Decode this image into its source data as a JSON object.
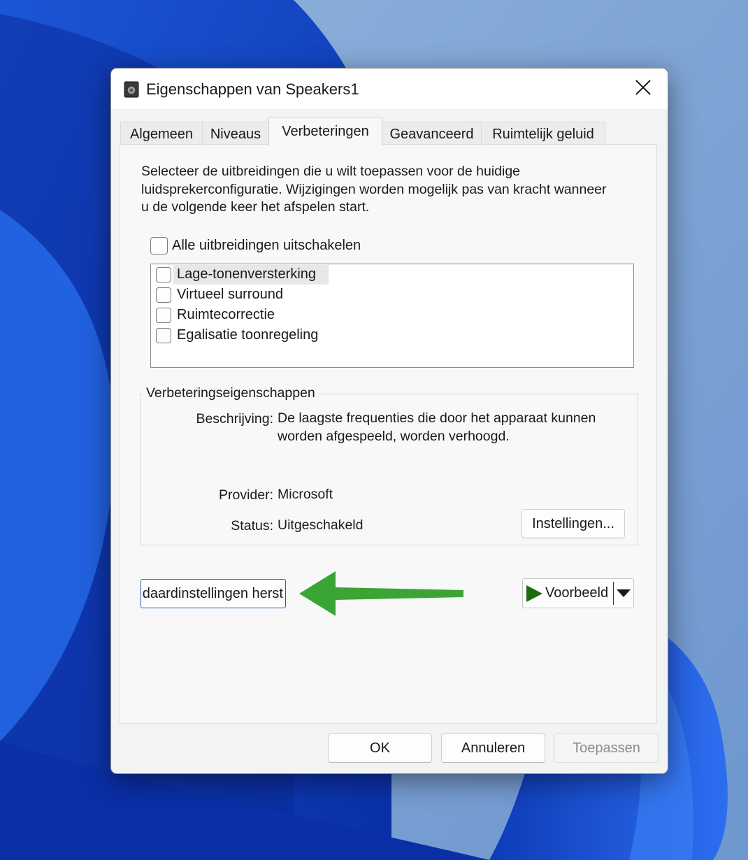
{
  "dialog": {
    "title": "Eigenschappen van Speakers1",
    "tabs": [
      "Algemeen",
      "Niveaus",
      "Verbeteringen",
      "Geavanceerd",
      "Ruimtelijk geluid"
    ],
    "active_tab": "Verbeteringen",
    "intro_text": "Selecteer de uitbreidingen die u wilt toepassen voor de huidige luidsprekerconfiguratie. Wijzigingen worden mogelijk pas van kracht wanneer u de volgende keer het afspelen start.",
    "disable_all": {
      "label": "Alle uitbreidingen uitschakelen",
      "checked": false
    },
    "enhancements": [
      {
        "label": "Lage-tonenversterking",
        "checked": false,
        "selected": true
      },
      {
        "label": "Virtueel surround",
        "checked": false,
        "selected": false
      },
      {
        "label": "Ruimtecorrectie",
        "checked": false,
        "selected": false
      },
      {
        "label": "Egalisatie toonregeling",
        "checked": false,
        "selected": false
      }
    ],
    "properties": {
      "caption": "Verbeteringseigenschappen",
      "description_label": "Beschrijving:",
      "description_value": "De laagste frequenties die door het apparaat kunnen worden afgespeeld, worden verhoogd.",
      "provider_label": "Provider:",
      "provider_value": "Microsoft",
      "status_label": "Status:",
      "status_value": "Uitgeschakeld",
      "settings_button": "Instellingen..."
    },
    "restore_button": "daardinstellingen herst",
    "preview_button": "Voorbeeld",
    "footer": {
      "ok": "OK",
      "cancel": "Annuleren",
      "apply": "Toepassen"
    }
  },
  "colors": {
    "accent_arrow": "#3aa535",
    "focus_border": "#1f5fb8",
    "play_icon": "#1f6b12"
  }
}
